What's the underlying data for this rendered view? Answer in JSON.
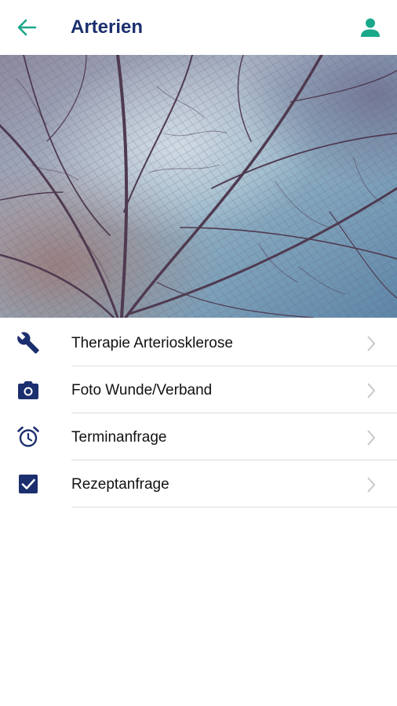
{
  "header": {
    "title": "Arterien",
    "back_icon": "arrow-left-icon",
    "profile_icon": "person-icon"
  },
  "colors": {
    "accent": "#1aa88a",
    "navy": "#1b2f6e",
    "divider": "#dcdcdc"
  },
  "hero": {
    "description_icon": "leaf-image"
  },
  "menu": {
    "items": [
      {
        "label": "Therapie Arteriosklerose",
        "icon": "wrench-icon"
      },
      {
        "label": "Foto Wunde/Verband",
        "icon": "camera-icon"
      },
      {
        "label": "Terminanfrage",
        "icon": "alarm-clock-icon"
      },
      {
        "label": "Rezeptanfrage",
        "icon": "checkbox-icon"
      }
    ]
  }
}
